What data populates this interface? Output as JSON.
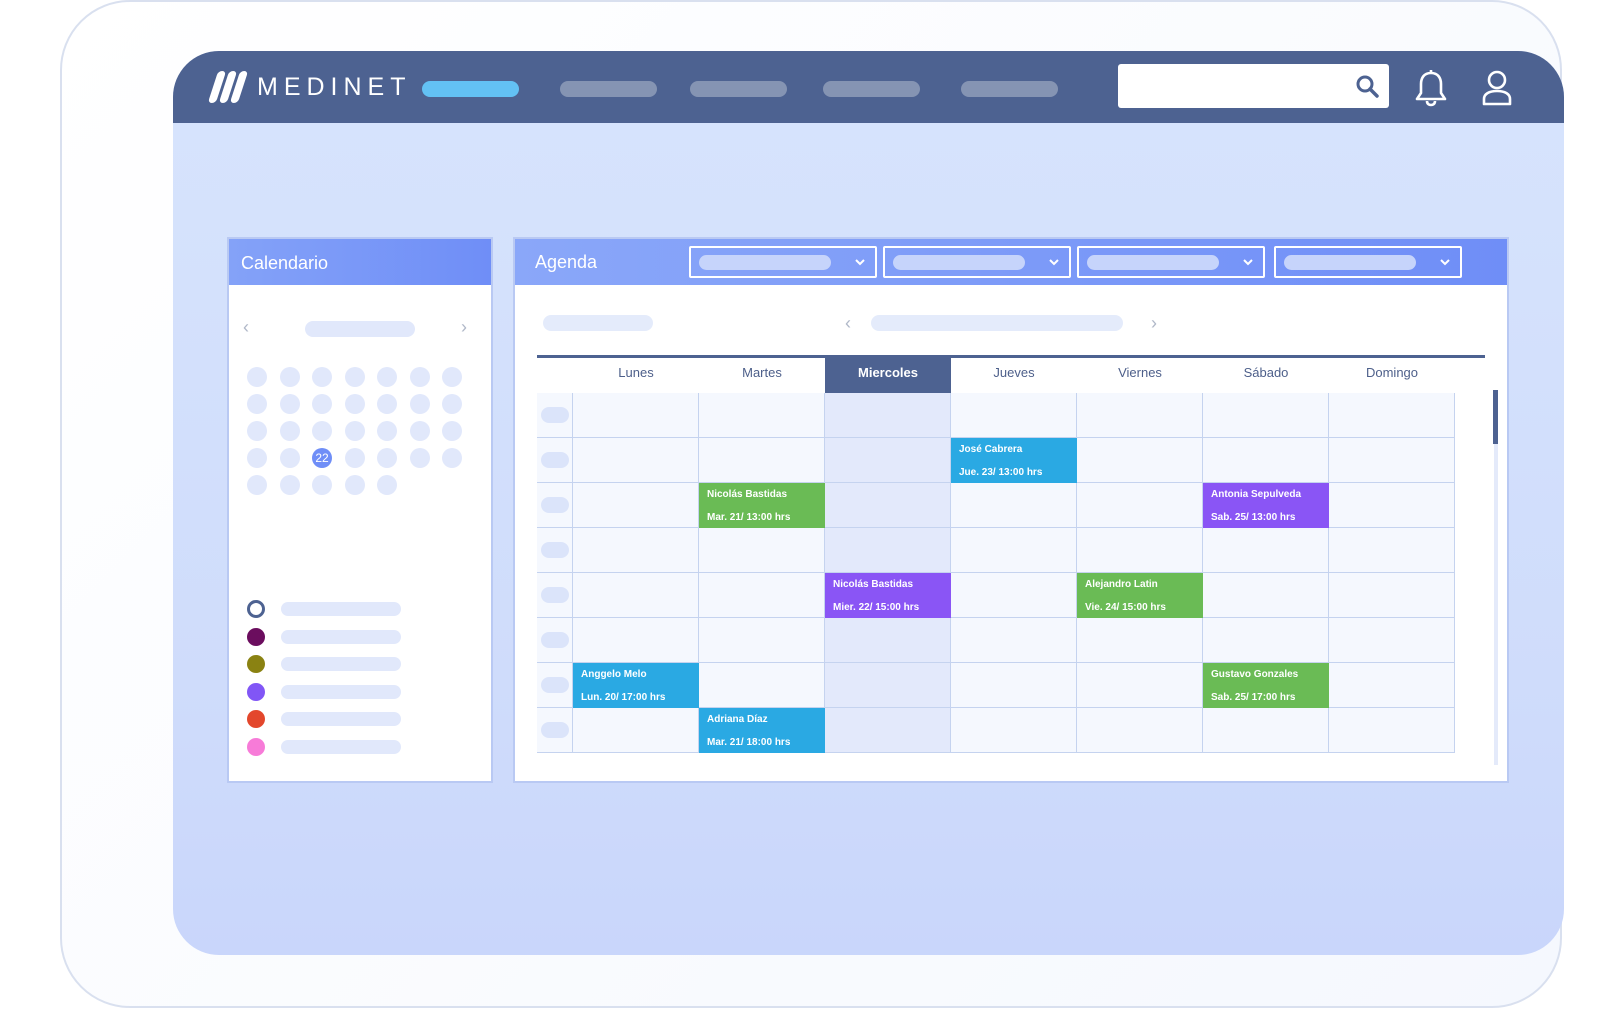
{
  "app": {
    "logo_text": "MEDINET"
  },
  "nav": {
    "items": [
      "",
      "",
      "",
      "",
      ""
    ],
    "active_index": 0
  },
  "search": {
    "placeholder": ""
  },
  "calendar": {
    "title": "Calendario",
    "selected_day": "22",
    "legend_colors": [
      "#4d6291",
      "#6b0d5e",
      "#8a8212",
      "#8156f6",
      "#e3472c",
      "#f77bd8"
    ]
  },
  "agenda": {
    "title": "Agenda",
    "days": [
      "Lunes",
      "Martes",
      "Miercoles",
      "Jueves",
      "Viernes",
      "Sábado",
      "Domingo"
    ],
    "active_day_index": 2,
    "events": [
      {
        "name": "José Cabrera",
        "when": "Jue. 23/ 13:00 hrs",
        "day": 3,
        "slot": 1,
        "color": "#2aa9e3"
      },
      {
        "name": "Nicolás Bastidas",
        "when": "Mar. 21/ 13:00 hrs",
        "day": 1,
        "slot": 2,
        "color": "#6abb55"
      },
      {
        "name": "Antonia Sepulveda",
        "when": "Sab. 25/ 13:00 hrs",
        "day": 5,
        "slot": 2,
        "color": "#8a55f5"
      },
      {
        "name": "Nicolás Bastidas",
        "when": "Mier. 22/ 15:00 hrs",
        "day": 2,
        "slot": 4,
        "color": "#8a55f5"
      },
      {
        "name": "Alejandro Latin",
        "when": "Vie. 24/ 15:00 hrs",
        "day": 4,
        "slot": 4,
        "color": "#6abb55"
      },
      {
        "name": "Anggelo Melo",
        "when": "Lun. 20/ 17:00 hrs",
        "day": 0,
        "slot": 6,
        "color": "#2aa9e3"
      },
      {
        "name": "Gustavo Gonzales",
        "when": "Sab. 25/ 17:00 hrs",
        "day": 5,
        "slot": 6,
        "color": "#6abb55"
      },
      {
        "name": "Adriana Díaz",
        "when": "Mar. 21/ 18:00 hrs",
        "day": 1,
        "slot": 7,
        "color": "#2aa9e3"
      }
    ]
  }
}
